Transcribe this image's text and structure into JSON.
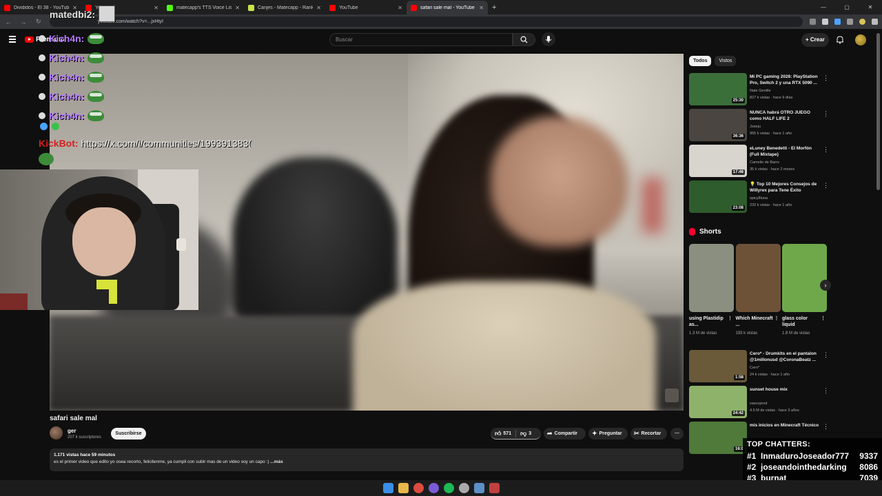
{
  "browser": {
    "tabs": [
      {
        "label": "Divididos - El 38 - YouTube",
        "color": "#ff0000",
        "active": false
      },
      {
        "label": "YouTube",
        "color": "#ff0000",
        "active": false
      },
      {
        "label": "matecapp's TTS Voice List | Kick",
        "color": "#53fc18",
        "active": false
      },
      {
        "label": "Canjes - Matecapp - Ranking y",
        "color": "#c8e34a",
        "active": false
      },
      {
        "label": "YouTube",
        "color": "#ff0000",
        "active": false
      },
      {
        "label": "safari sale mal - YouTube",
        "color": "#ff0000",
        "active": true
      }
    ],
    "url": "youtube.com/watch?v=...jxHtyI"
  },
  "header": {
    "logo_label": "Premium",
    "search_placeholder": "Buscar",
    "create_label": "Crear"
  },
  "overlay": {
    "top_user": "matedbi2:",
    "chat_name": "Kich4n:",
    "chat_count": 5,
    "bot_name": "KickBot:",
    "bot_message": "https://x.com/i/communities/199391383(",
    "top_chatters_title": "TOP CHATTERS:",
    "top_chatters": [
      {
        "rank": "#1",
        "name": "InmaduroJoseador777",
        "count": "9337"
      },
      {
        "rank": "#2",
        "name": "joseandointhedarking",
        "count": "8086"
      },
      {
        "rank": "#3",
        "name": "burnat",
        "count": "7039"
      }
    ]
  },
  "video": {
    "title": "safari sale mal",
    "channel": "ger",
    "subscribers": "207 k suscriptores",
    "subscribe_label": "Suscribirse",
    "likes": "571",
    "dislikes": "3",
    "share_label": "Compartir",
    "ask_label": "Preguntar",
    "clip_label": "Recortar",
    "description_meta": "1.171 vistas  hace 59 minutos",
    "description_text": "es el primer video que edito yo osea recorto, felicitenme, ya cumpli con subir mas de un video soy un capo :)",
    "description_more": " ...más"
  },
  "sidebar": {
    "chips": [
      "Todos",
      "Vistos"
    ],
    "recs_top": [
      {
        "title": "Mi PC gaming 2026: PlayStation Pro, Switch 2 y una RTX 5090 ...",
        "channel": "Nate Gentile",
        "meta": "827 k vistas · hace 9 días",
        "duration": "25:30",
        "thumb": "#3b6f3a"
      },
      {
        "title": "NUNCA habrá OTRO JUEGO como HALF LIFE 2",
        "channel": "Joseju",
        "meta": "955 k vistas · hace 1 año",
        "duration": "36:36",
        "thumb": "#4a4540"
      },
      {
        "title": "eLuney Benedetti - El Morfón (Full Mixtape)",
        "channel": "Camelio de Barro",
        "meta": "35 k vistas · hace 2 meses",
        "duration": "17:48",
        "thumb": "#d8d4ce"
      },
      {
        "title": "💡 Top 10 Mejores Consejos de Willyrex para Tene Éxito",
        "channel": "spicy8luna",
        "meta": "232 k vistas · hace 1 año",
        "duration": "23:08",
        "thumb": "#2f5c2c"
      }
    ],
    "shorts_title": "Shorts",
    "shorts": [
      {
        "label": "using Plastidip as...",
        "views": "1.3 M de vistas",
        "color": "#8a8f7f"
      },
      {
        "label": "Which Minecraft ...",
        "views": "193 k vistas",
        "color": "#6d5238"
      },
      {
        "label": "glass color liquid",
        "views": "1.8 M de vistas",
        "color": "#6fa84a"
      }
    ],
    "recs_bottom": [
      {
        "title": "Cero* - Drumkits en el pantalon @1millonusd @CoronaBeatz ...",
        "channel": "Cero*",
        "meta": "24 k vistas · hace 1 año",
        "duration": "1:58",
        "thumb": "#6a5a3a"
      },
      {
        "title": "sunset house mix",
        "channel": "vascoprod",
        "meta": "4.5 M de vistas · hace 3 años",
        "duration": "24:42",
        "thumb": "#8fb26a"
      },
      {
        "title": "mis inicios en Minecraft Técnico",
        "channel": "",
        "meta": "",
        "duration": "16:0",
        "thumb": "#4f7a3a"
      }
    ]
  }
}
